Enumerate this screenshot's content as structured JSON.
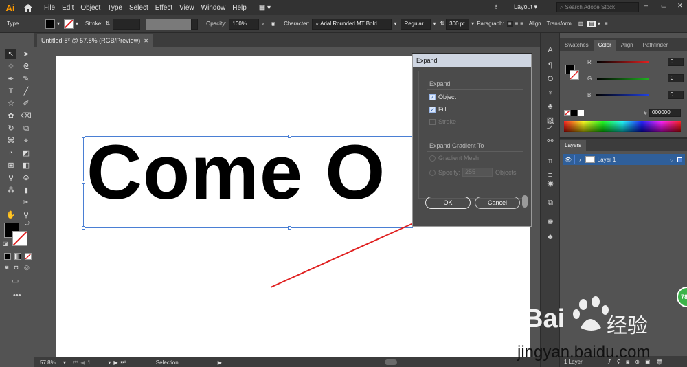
{
  "app": {
    "logo": "Ai"
  },
  "menu": [
    "File",
    "Edit",
    "Object",
    "Type",
    "Select",
    "Effect",
    "View",
    "Window",
    "Help"
  ],
  "menubar_right": {
    "workspace": "Layout",
    "search_placeholder": "Search Adobe Stock"
  },
  "control_bar": {
    "selection_type": "Type",
    "stroke_label": "Stroke:",
    "opacity_label": "Opacity:",
    "opacity_value": "100%",
    "character_label": "Character:",
    "font_family": "Arial Rounded MT Bold",
    "font_style": "Regular",
    "font_size": "300 pt",
    "paragraph_label": "Paragraph:",
    "align_label": "Align",
    "transform_label": "Transform"
  },
  "document": {
    "tab_title": "Untitled-8* @ 57.8% (RGB/Preview)",
    "artboard_text": "Come O"
  },
  "status_bar": {
    "zoom": "57.8%",
    "page": "1",
    "tool": "Selection"
  },
  "color_panel": {
    "tabs": [
      "Swatches",
      "Color",
      "Align",
      "Pathfinder"
    ],
    "active_tab": "Color",
    "channels": [
      {
        "name": "R",
        "value": "0",
        "color": "#e02020"
      },
      {
        "name": "G",
        "value": "0",
        "color": "#20b020"
      },
      {
        "name": "B",
        "value": "0",
        "color": "#2040e0"
      }
    ],
    "hex_label": "#",
    "hex_value": "000000"
  },
  "layers_panel": {
    "title": "Layers",
    "layer_name": "Layer 1",
    "footer": "1 Layer"
  },
  "expand_dialog": {
    "title": "Expand",
    "section_expand": "Expand",
    "object_label": "Object",
    "object_checked": true,
    "fill_label": "Fill",
    "fill_checked": true,
    "stroke_label": "Stroke",
    "stroke_checked": false,
    "section_gradient": "Expand Gradient To",
    "gradient_mesh_label": "Gradient Mesh",
    "specify_label": "Specify:",
    "specify_value": "255",
    "objects_label": "Objects",
    "ok_label": "OK",
    "cancel_label": "Cancel"
  },
  "watermark": {
    "logo_text": "Bai",
    "logo_text2": "经验",
    "url": "jingyan.baidu.com",
    "badge": "78"
  },
  "colors": {
    "accent_blue": "#4a7fd4",
    "arrow_red": "#e02020",
    "app_orange": "#ff9a00"
  }
}
